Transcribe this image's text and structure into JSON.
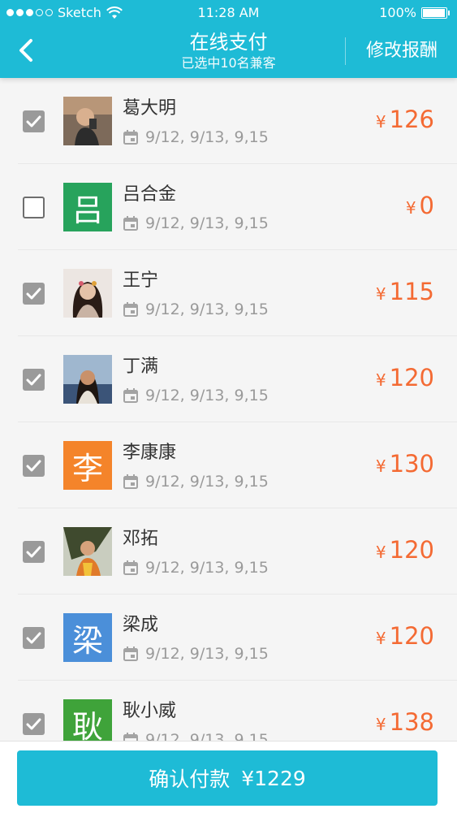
{
  "status_bar": {
    "carrier": "Sketch",
    "time": "11:28 AM",
    "battery": "100%",
    "battery_level": 1.0
  },
  "header": {
    "title": "在线支付",
    "subtitle": "已选中10名兼客",
    "edit_label": "修改报酬"
  },
  "rows": [
    {
      "name": "葛大明",
      "dates": "9/12, 9/13, 9,15",
      "currency": "¥",
      "amount": "126",
      "checked": true,
      "avatar_type": "photo",
      "avatar_letter": "",
      "avatar_color": "#7a5a44"
    },
    {
      "name": "吕合金",
      "dates": "9/12, 9/13, 9,15",
      "currency": "¥",
      "amount": "0",
      "checked": false,
      "avatar_type": "letter",
      "avatar_letter": "吕",
      "avatar_color": "#27a35c"
    },
    {
      "name": "王宁",
      "dates": "9/12, 9/13, 9,15",
      "currency": "¥",
      "amount": "115",
      "checked": true,
      "avatar_type": "photo",
      "avatar_letter": "",
      "avatar_color": "#5a4036"
    },
    {
      "name": "丁满",
      "dates": "9/12, 9/13, 9,15",
      "currency": "¥",
      "amount": "120",
      "checked": true,
      "avatar_type": "photo",
      "avatar_letter": "",
      "avatar_color": "#4f6a8a"
    },
    {
      "name": "李康康",
      "dates": "9/12, 9/13, 9,15",
      "currency": "¥",
      "amount": "130",
      "checked": true,
      "avatar_type": "letter",
      "avatar_letter": "李",
      "avatar_color": "#f4842a"
    },
    {
      "name": "邓拓",
      "dates": "9/12, 9/13, 9,15",
      "currency": "¥",
      "amount": "120",
      "checked": true,
      "avatar_type": "photo",
      "avatar_letter": "",
      "avatar_color": "#8a6a52"
    },
    {
      "name": "梁成",
      "dates": "9/12, 9/13, 9,15",
      "currency": "¥",
      "amount": "120",
      "checked": true,
      "avatar_type": "letter",
      "avatar_letter": "梁",
      "avatar_color": "#4b8fd9"
    },
    {
      "name": "耿小威",
      "dates": "9/12, 9/13, 9,15",
      "currency": "¥",
      "amount": "138",
      "checked": true,
      "avatar_type": "letter",
      "avatar_letter": "耿",
      "avatar_color": "#3fa33a"
    }
  ],
  "footer": {
    "pay_label": "确认付款",
    "currency": "¥",
    "total": "1229"
  },
  "colors": {
    "accent": "#1ebbd6",
    "price": "#f46a33"
  }
}
